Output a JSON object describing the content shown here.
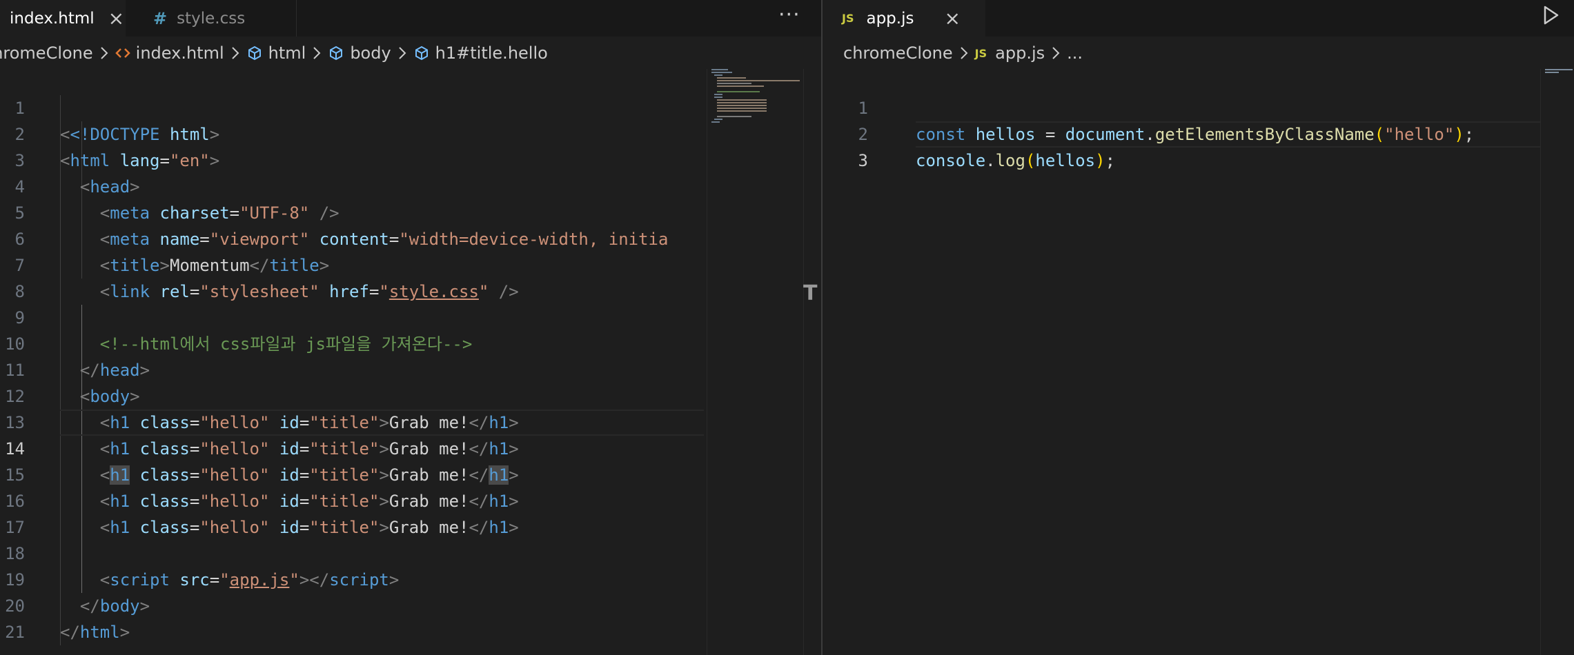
{
  "left": {
    "tabs": [
      {
        "name": "index.html",
        "active": true
      },
      {
        "name": "style.css",
        "active": false
      }
    ],
    "tab_close": "×",
    "css_icon": "#",
    "more": "···",
    "breadcrumb": {
      "folder": "chromeClone",
      "file": "index.html",
      "path": [
        "html",
        "body",
        "h1#title.hello"
      ]
    },
    "line_numbers": [
      "1",
      "2",
      "3",
      "4",
      "5",
      "6",
      "7",
      "8",
      "9",
      "10",
      "11",
      "12",
      "13",
      "14",
      "15",
      "16",
      "17",
      "18",
      "19",
      "20",
      "21"
    ],
    "current_line": "14",
    "code": {
      "l1_doctype": "<!DOCTYPE",
      "l1_html": "html",
      "l1_close": ">",
      "lt": "<",
      "gt": ">",
      "lts": "</",
      "sc": " />",
      "eq": "=",
      "html": "html",
      "head": "head",
      "meta": "meta",
      "title": "title",
      "link": "link",
      "body": "body",
      "h1": "h1",
      "script": "script",
      "lang": "lang",
      "en": "\"en\"",
      "charset": "charset",
      "utf8": "\"UTF-8\"",
      "name": "name",
      "viewport": "\"viewport\"",
      "content": "content",
      "content_val": "\"width=device-width, initia",
      "title_text": "Momentum",
      "rel": "rel",
      "stylesheet": "\"stylesheet\"",
      "href": "href",
      "q": "\"",
      "style_css": "style.css",
      "comment": "<!--html에서 css파일과 js파일을 가져온다-->",
      "class": "class",
      "hello": "\"hello\"",
      "id": "id",
      "title_id": "\"title\"",
      "grab": "Grab me!",
      "src": "src",
      "app_js": "app.js"
    }
  },
  "right": {
    "tab": {
      "name": "app.js",
      "icon": "JS"
    },
    "tab_close": "×",
    "breadcrumb": {
      "folder": "chromeClone",
      "file_icon": "JS",
      "file": "app.js",
      "rest": "..."
    },
    "line_numbers": [
      "1",
      "2",
      "3"
    ],
    "current_line": "3",
    "code": {
      "const": "const",
      "hellos": "hellos",
      "eq": " = ",
      "document": "document",
      "dot": ".",
      "getEl": "getElementsByClassName",
      "lp": "(",
      "hello_str": "\"hello\"",
      "rp": ")",
      "semi": ";",
      "console": "console",
      "log": "log"
    }
  },
  "colors": {
    "background": "#1e1e1e",
    "tabbar": "#181818",
    "keyword": "#569cd6",
    "string": "#ce9178",
    "attribute": "#9cdcfe",
    "comment": "#6a9955",
    "function": "#dcdcaa"
  },
  "icons": {
    "run": "play-icon",
    "more": "more-actions-icon",
    "breadcrumb_sep": "chevron-right-icon",
    "element": "symbol-element-icon"
  }
}
